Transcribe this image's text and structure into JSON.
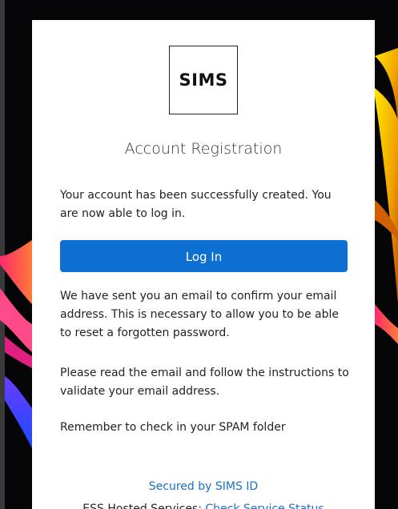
{
  "logo": {
    "text": "SIMS"
  },
  "header": {
    "title": "Account Registration"
  },
  "messages": {
    "created": "Your account has been successfully created. You are now able to log in.",
    "email_sent": "We have sent you an email to confirm your email address. This is necessary to allow you to be able to reset a forgotten password.",
    "follow_instructions": "Please read the email and follow the instructions to validate your email address.",
    "spam_reminder": "Remember to check in your SPAM folder"
  },
  "actions": {
    "login_label": "Log In"
  },
  "footer": {
    "secured_by": "Secured by SIMS ID",
    "ess_prefix": "ESS Hosted Services: ",
    "status_link": "Check Service Status"
  },
  "colors": {
    "primary_button": "#0d6fd2",
    "link": "#1a6fc9",
    "card_background": "#ffffff",
    "page_background": "#050508"
  }
}
